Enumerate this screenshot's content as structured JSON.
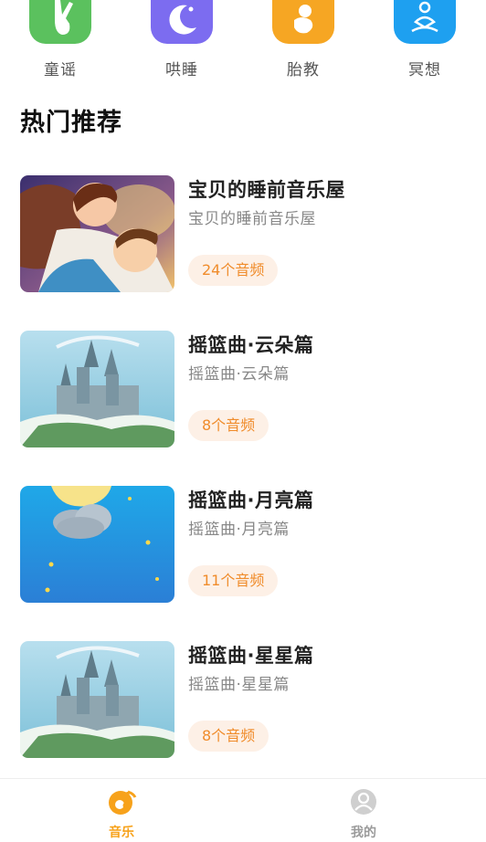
{
  "categories": [
    {
      "label": "童谣",
      "color": "#5bc15e",
      "icon": "rabbit-icon"
    },
    {
      "label": "哄睡",
      "color": "#7c6cf0",
      "icon": "moon-icon"
    },
    {
      "label": "胎教",
      "color": "#f6a623",
      "icon": "baby-icon"
    },
    {
      "label": "冥想",
      "color": "#1ea0f0",
      "icon": "meditation-icon"
    }
  ],
  "section_title": "热门推荐",
  "playlists": [
    {
      "title": "宝贝的睡前音乐屋",
      "subtitle": "宝贝的睡前音乐屋",
      "count": "24个音频",
      "thumb": "mother-baby-illustration"
    },
    {
      "title": "摇篮曲·云朵篇",
      "subtitle": "摇篮曲·云朵篇",
      "count": "8个音频",
      "thumb": "castle-illustration"
    },
    {
      "title": "摇篮曲·月亮篇",
      "subtitle": "摇篮曲·月亮篇",
      "count": "11个音频",
      "thumb": "moon-cloud-illustration"
    },
    {
      "title": "摇篮曲·星星篇",
      "subtitle": "摇篮曲·星星篇",
      "count": "8个音频",
      "thumb": "castle-illustration"
    }
  ],
  "tabbar": {
    "items": [
      {
        "label": "音乐",
        "icon": "music-icon",
        "active": true
      },
      {
        "label": "我的",
        "icon": "profile-icon",
        "active": false
      }
    ],
    "active_color": "#f7a21b",
    "inactive_color": "#9a9a9a"
  },
  "colors": {
    "accent": "#f08c2b",
    "badge_bg": "#fdf0e6"
  }
}
